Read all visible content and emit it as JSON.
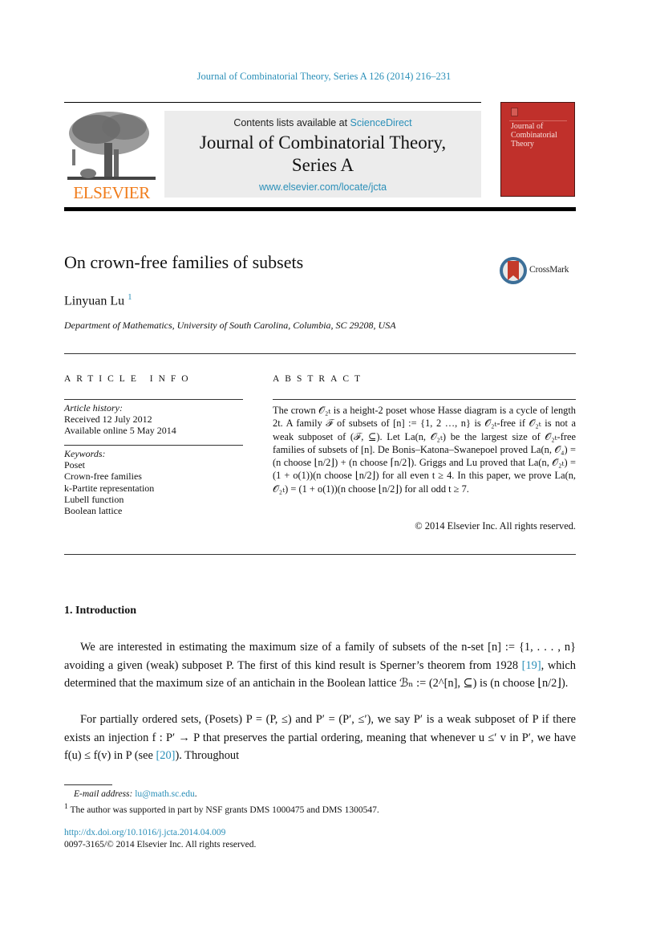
{
  "journal_reference": "Journal of Combinatorial Theory, Series A 126 (2014) 216–231",
  "header": {
    "contents_prefix": "Contents lists available at ",
    "contents_link": "ScienceDirect",
    "journal_title_line1": "Journal of Combinatorial Theory,",
    "journal_title_line2": "Series A",
    "journal_url": "www.elsevier.com/locate/jcta",
    "publisher_logo_text": "ELSEVIER",
    "cover_title": "Journal of Combinatorial Theory",
    "colors": {
      "link": "#2a8fb8",
      "elsevier_orange": "#f07c1b",
      "cover_red": "#c0302b",
      "header_box": "#ececec"
    }
  },
  "paper": {
    "title": "On crown-free families of subsets",
    "crossmark_label": "CrossMark",
    "author": "Linyuan Lu",
    "author_footnote_mark": "1",
    "affiliation": "Department of Mathematics, University of South Carolina, Columbia, SC 29208, USA"
  },
  "article_info": {
    "heading": "ARTICLE INFO",
    "history_label": "Article history:",
    "history": [
      "Received 12 July 2012",
      "Available online 5 May 2014"
    ],
    "keywords_label": "Keywords:",
    "keywords": [
      "Poset",
      "Crown-free families",
      "k-Partite representation",
      "Lubell function",
      "Boolean lattice"
    ]
  },
  "abstract": {
    "heading": "ABSTRACT",
    "text": "The crown 𝒪₂ₜ is a height-2 poset whose Hasse diagram is a cycle of length 2t. A family ℱ of subsets of [n] := {1, 2 …, n} is 𝒪₂ₜ-free if 𝒪₂ₜ is not a weak subposet of (ℱ, ⊆). Let La(n, 𝒪₂ₜ) be the largest size of 𝒪₂ₜ-free families of subsets of [n]. De Bonis–Katona–Swanepoel proved La(n, 𝒪₄) = (n choose ⌊n/2⌋) + (n choose ⌈n/2⌉). Griggs and Lu proved that La(n, 𝒪₂ₜ) = (1 + o(1))(n choose ⌊n/2⌋) for all even t ≥ 4. In this paper, we prove La(n, 𝒪₂ₜ) = (1 + o(1))(n choose ⌊n/2⌋) for all odd t ≥ 7.",
    "copyright": "© 2014 Elsevier Inc. All rights reserved."
  },
  "body": {
    "section_heading": "1.  Introduction",
    "paragraph_1": "We are interested in estimating the maximum size of a family of subsets of the n-set [n] := {1, . . . , n} avoiding a given (weak) subposet P. The first of this kind result is Sperner’s theorem from 1928 [19], which determined that the maximum size of an antichain in the Boolean lattice ℬₙ := (2^[n], ⊆) is (n choose ⌊n/2⌋).",
    "paragraph_2": "For partially ordered sets, (Posets) P = (P, ≤) and P′ = (P′, ≤′), we say P′ is a weak subposet of P if there exists an injection f : P′ → P that preserves the partial ordering, meaning that whenever u ≤′ v in P′, we have f(u) ≤ f(v) in P (see [20]). Throughout",
    "citations": [
      "[19]",
      "[20]"
    ]
  },
  "footnotes": {
    "email_label": "E-mail address: ",
    "email": "lu@math.sc.edu",
    "note_1_mark": "1",
    "note_1": "The author was supported in part by NSF grants DMS 1000475 and DMS 1300547."
  },
  "footer": {
    "doi": "http://dx.doi.org/10.1016/j.jcta.2014.04.009",
    "issn": "0097-3165/© 2014 Elsevier Inc. All rights reserved."
  }
}
